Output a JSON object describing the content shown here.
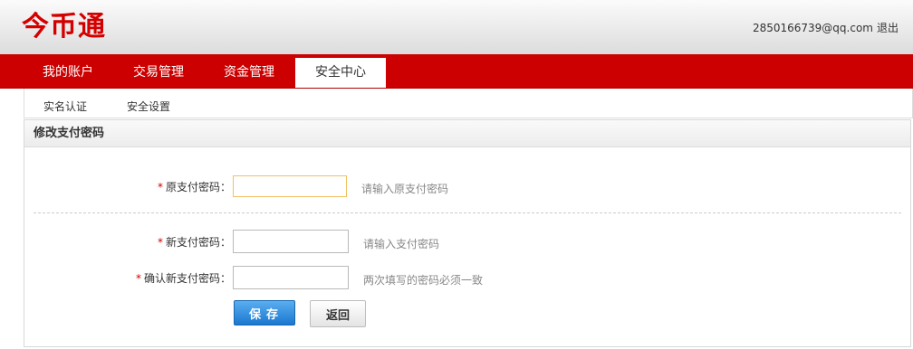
{
  "header": {
    "logo": "今币通",
    "user_email": "2850166739@qq.com",
    "logout_label": "退出"
  },
  "nav": {
    "tabs": [
      {
        "label": "我的账户",
        "active": false
      },
      {
        "label": "交易管理",
        "active": false
      },
      {
        "label": "资金管理",
        "active": false
      },
      {
        "label": "安全中心",
        "active": true
      }
    ]
  },
  "subnav": {
    "items": [
      {
        "label": "实名认证"
      },
      {
        "label": "安全设置"
      }
    ]
  },
  "panel": {
    "title": "修改支付密码",
    "fields": [
      {
        "required_mark": "*",
        "label": "原支付密码：",
        "value": "",
        "hint": "请输入原支付密码"
      },
      {
        "required_mark": "*",
        "label": "新支付密码：",
        "value": "",
        "hint": "请输入支付密码"
      },
      {
        "required_mark": "*",
        "label": "确认新支付密码：",
        "value": "",
        "hint": "两次填写的密码必须一致"
      }
    ],
    "save_label": "保存",
    "back_label": "返回"
  },
  "colors": {
    "brand_red": "#cc0000",
    "logo_red": "#d40000",
    "save_blue": "#1b78d0",
    "focus_border": "#f0c060"
  }
}
